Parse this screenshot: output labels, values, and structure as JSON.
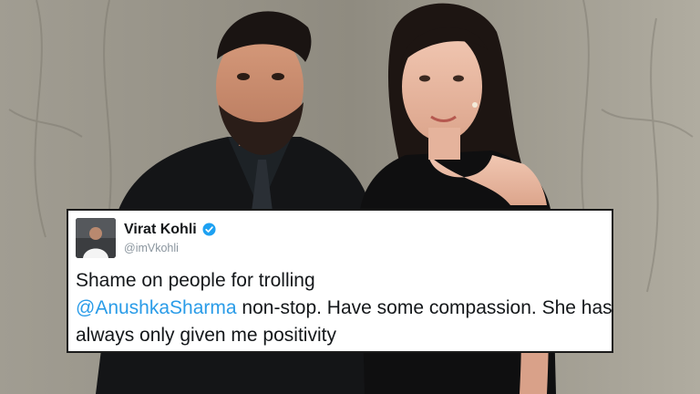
{
  "tweet": {
    "name": "Virat Kohli",
    "handle": "@imVkohli",
    "text_start": "Shame on people for trolling",
    "mention": "@AnushkaSharma",
    "text_end": " non-stop. Have some compassion. She has always only given me positivity"
  },
  "colors": {
    "link": "#2a9ce8",
    "verified": "#1da1f2"
  },
  "icons": {
    "verified": "verified-badge-icon",
    "avatar": "profile-photo"
  }
}
